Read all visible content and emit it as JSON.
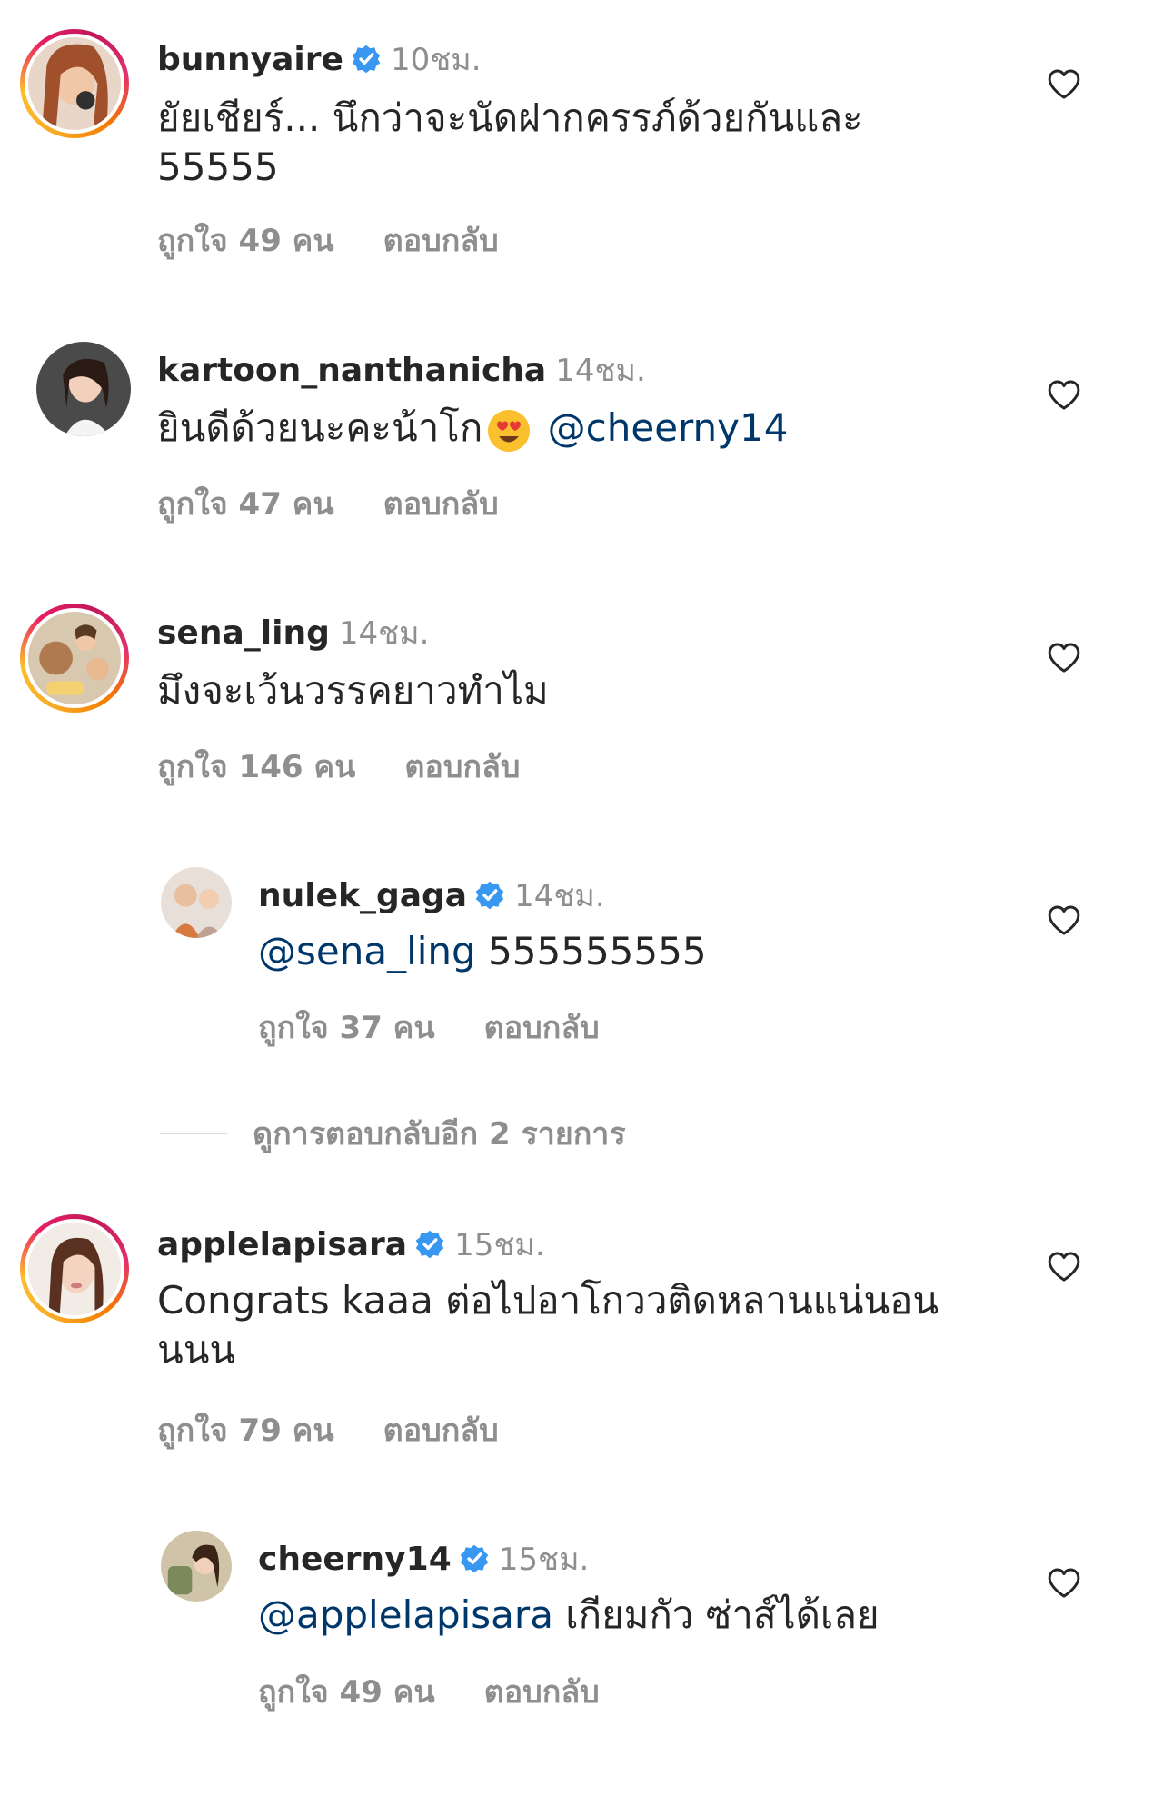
{
  "comments": [
    {
      "username": "bunnyaire",
      "verified": true,
      "time": "10ชม.",
      "text_line1": "ยัยเชียร์... นึกว่าจะนัดฝากครรภ์ด้วยกันและ",
      "text_line2": "55555",
      "likes": "ถูกใจ 49 คน",
      "reply": "ตอบกลับ",
      "avatar_color": "#b8735a"
    },
    {
      "username": "kartoon_nanthanicha",
      "verified": false,
      "time": "14ชม.",
      "text": "ยินดีด้วยนะคะน้าโก",
      "emoji": "heart-eyes-emoji",
      "mention": "@cheerny14",
      "likes": "ถูกใจ 47 คน",
      "reply": "ตอบกลับ",
      "avatar_color": "#3a3a3a"
    },
    {
      "username": "sena_ling",
      "verified": false,
      "time": "14ชม.",
      "text": "มึงจะเว้นวรรคยาวทำไม",
      "likes": "ถูกใจ 146 คน",
      "reply": "ตอบกลับ",
      "avatar_color": "#8a7a6a"
    },
    {
      "username": "nulek_gaga",
      "verified": true,
      "time": "14ชม.",
      "mention": "@sena_ling",
      "text": "555555555",
      "likes": "ถูกใจ 37 คน",
      "reply": "ตอบกลับ",
      "avatar_color": "#c9a48a"
    },
    {
      "username": "applelapisara",
      "verified": true,
      "time": "15ชม.",
      "text_line1": "Congrats kaaa ต่อไปอาโกววติดหลานแน่นอน",
      "text_line2": "นนน",
      "likes": "ถูกใจ 79 คน",
      "reply": "ตอบกลับ",
      "avatar_color": "#d8c0b0"
    },
    {
      "username": "cheerny14",
      "verified": true,
      "time": "15ชม.",
      "mention": "@applelapisara",
      "text": "เกียมกัว ซ่าส์ได้เลย",
      "likes": "ถูกใจ 49 คน",
      "reply": "ตอบกลับ",
      "avatar_color": "#a89878"
    }
  ],
  "more_replies": "ดูการตอบกลับอีก 2 รายการ",
  "colors": {
    "text": "#262626",
    "secondary": "#8e8e8e",
    "mention": "#00376b",
    "verified": "#3897f0"
  }
}
